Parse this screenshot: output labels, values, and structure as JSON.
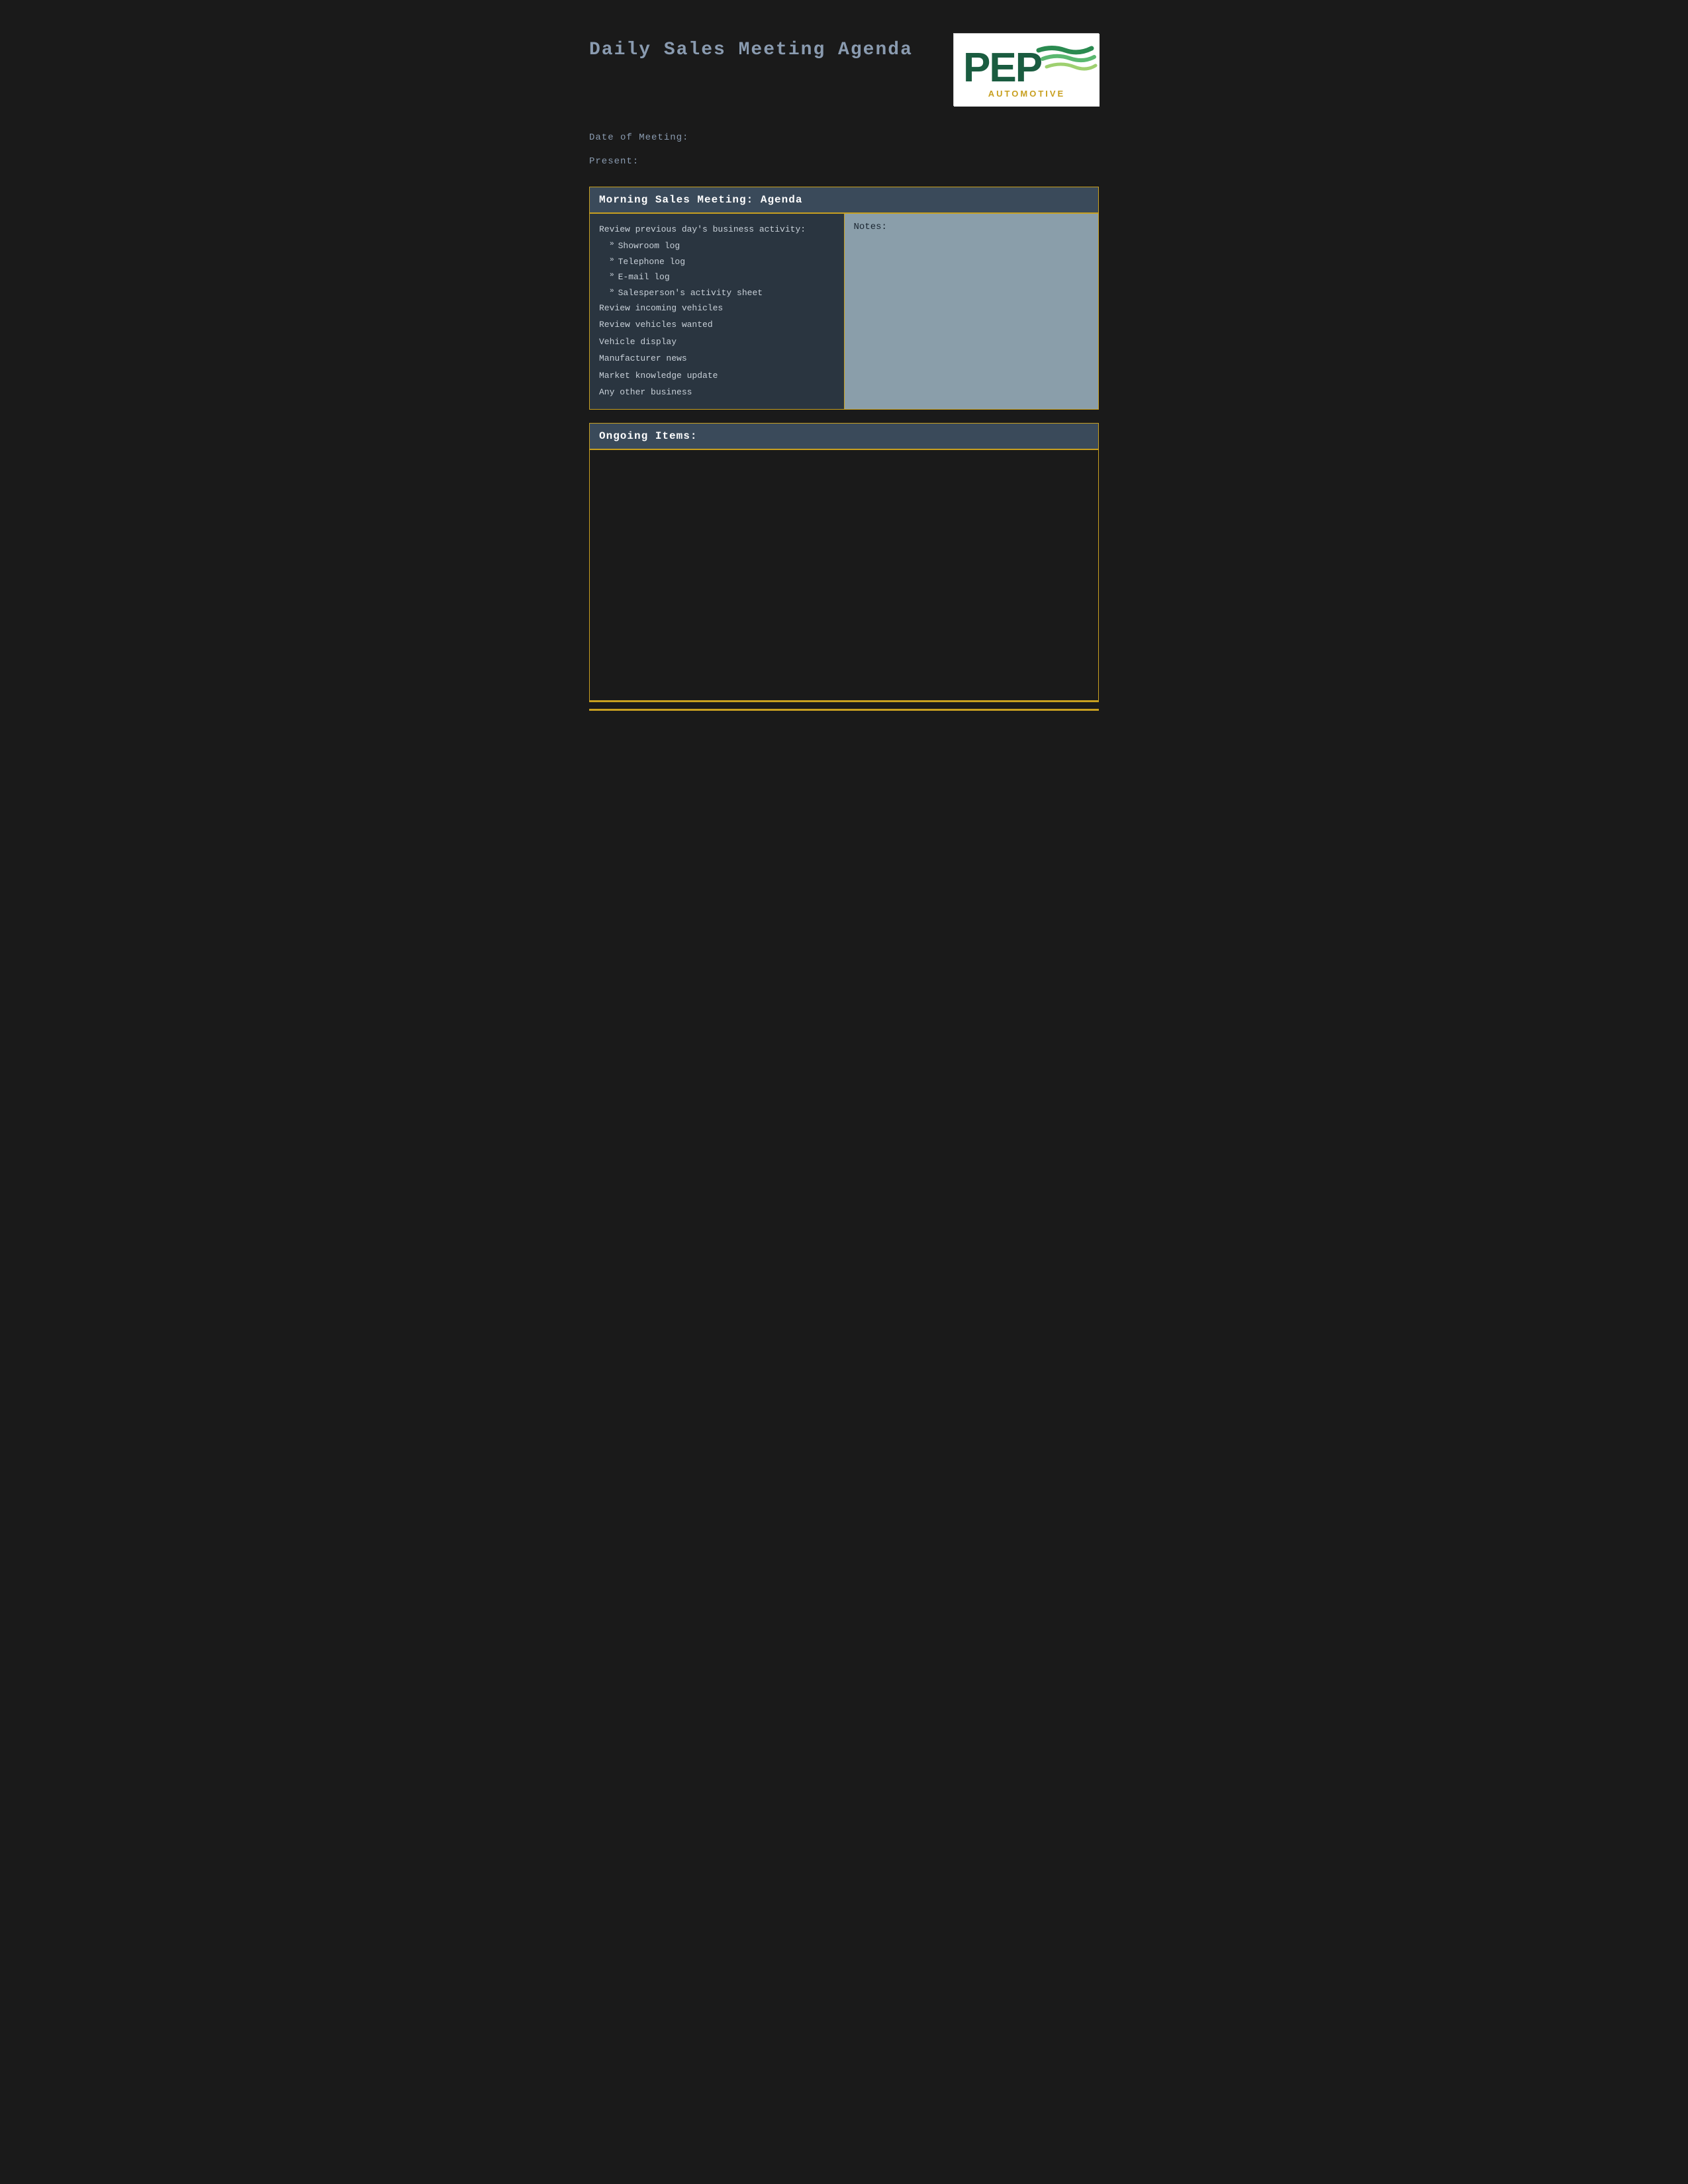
{
  "header": {
    "title": "Daily Sales Meeting Agenda",
    "logo": {
      "pep_text": "PEP",
      "automotive_text": "AUTOMOTIVE"
    }
  },
  "meta": {
    "date_label": "Date of Meeting:",
    "present_label": "Present:"
  },
  "morning_section": {
    "header": "Morning Sales Meeting: Agenda",
    "agenda_items": [
      {
        "text": "Review previous day’s business activity:",
        "type": "main"
      },
      {
        "text": "Showroom log",
        "type": "sub"
      },
      {
        "text": "Telephone log",
        "type": "sub"
      },
      {
        "text": "E-mail log",
        "type": "sub"
      },
      {
        "text": "Salesperson’s activity sheet",
        "type": "sub"
      },
      {
        "text": "Review incoming vehicles",
        "type": "main"
      },
      {
        "text": "Review vehicles wanted",
        "type": "main"
      },
      {
        "text": "Vehicle display",
        "type": "main"
      },
      {
        "text": "Manufacturer news",
        "type": "main"
      },
      {
        "text": "Market knowledge update",
        "type": "main"
      },
      {
        "text": "Any other business",
        "type": "main"
      }
    ],
    "notes_label": "Notes:"
  },
  "ongoing_section": {
    "header": "Ongoing Items:"
  }
}
